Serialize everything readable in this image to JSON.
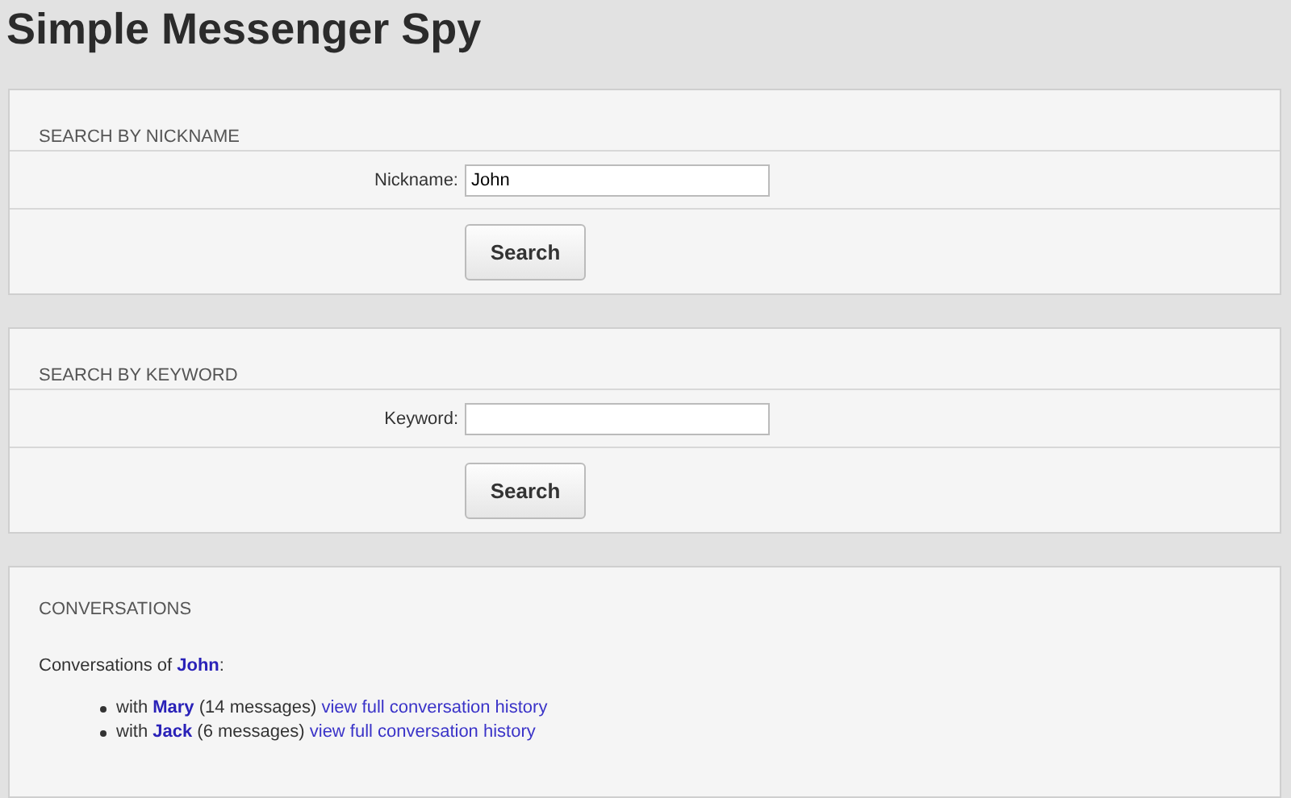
{
  "title": "Simple Messenger Spy",
  "search_panels": [
    {
      "heading": "SEARCH BY NICKNAME",
      "field_label": "Nickname:",
      "value": "John",
      "button": "Search"
    },
    {
      "heading": "SEARCH BY KEYWORD",
      "field_label": "Keyword:",
      "button": "Search"
    }
  ],
  "conversations": {
    "heading": "CONVERSATIONS",
    "intro": "Conversations of",
    "owner": "John",
    "colon": ":",
    "items": [
      {
        "prefix": "with",
        "contact": "Mary",
        "count": "(14 messages)",
        "link": "view full conversation history"
      },
      {
        "prefix": "with",
        "contact": "Jack",
        "count": "(6 messages)",
        "link": "view full conversation history"
      }
    ]
  }
}
